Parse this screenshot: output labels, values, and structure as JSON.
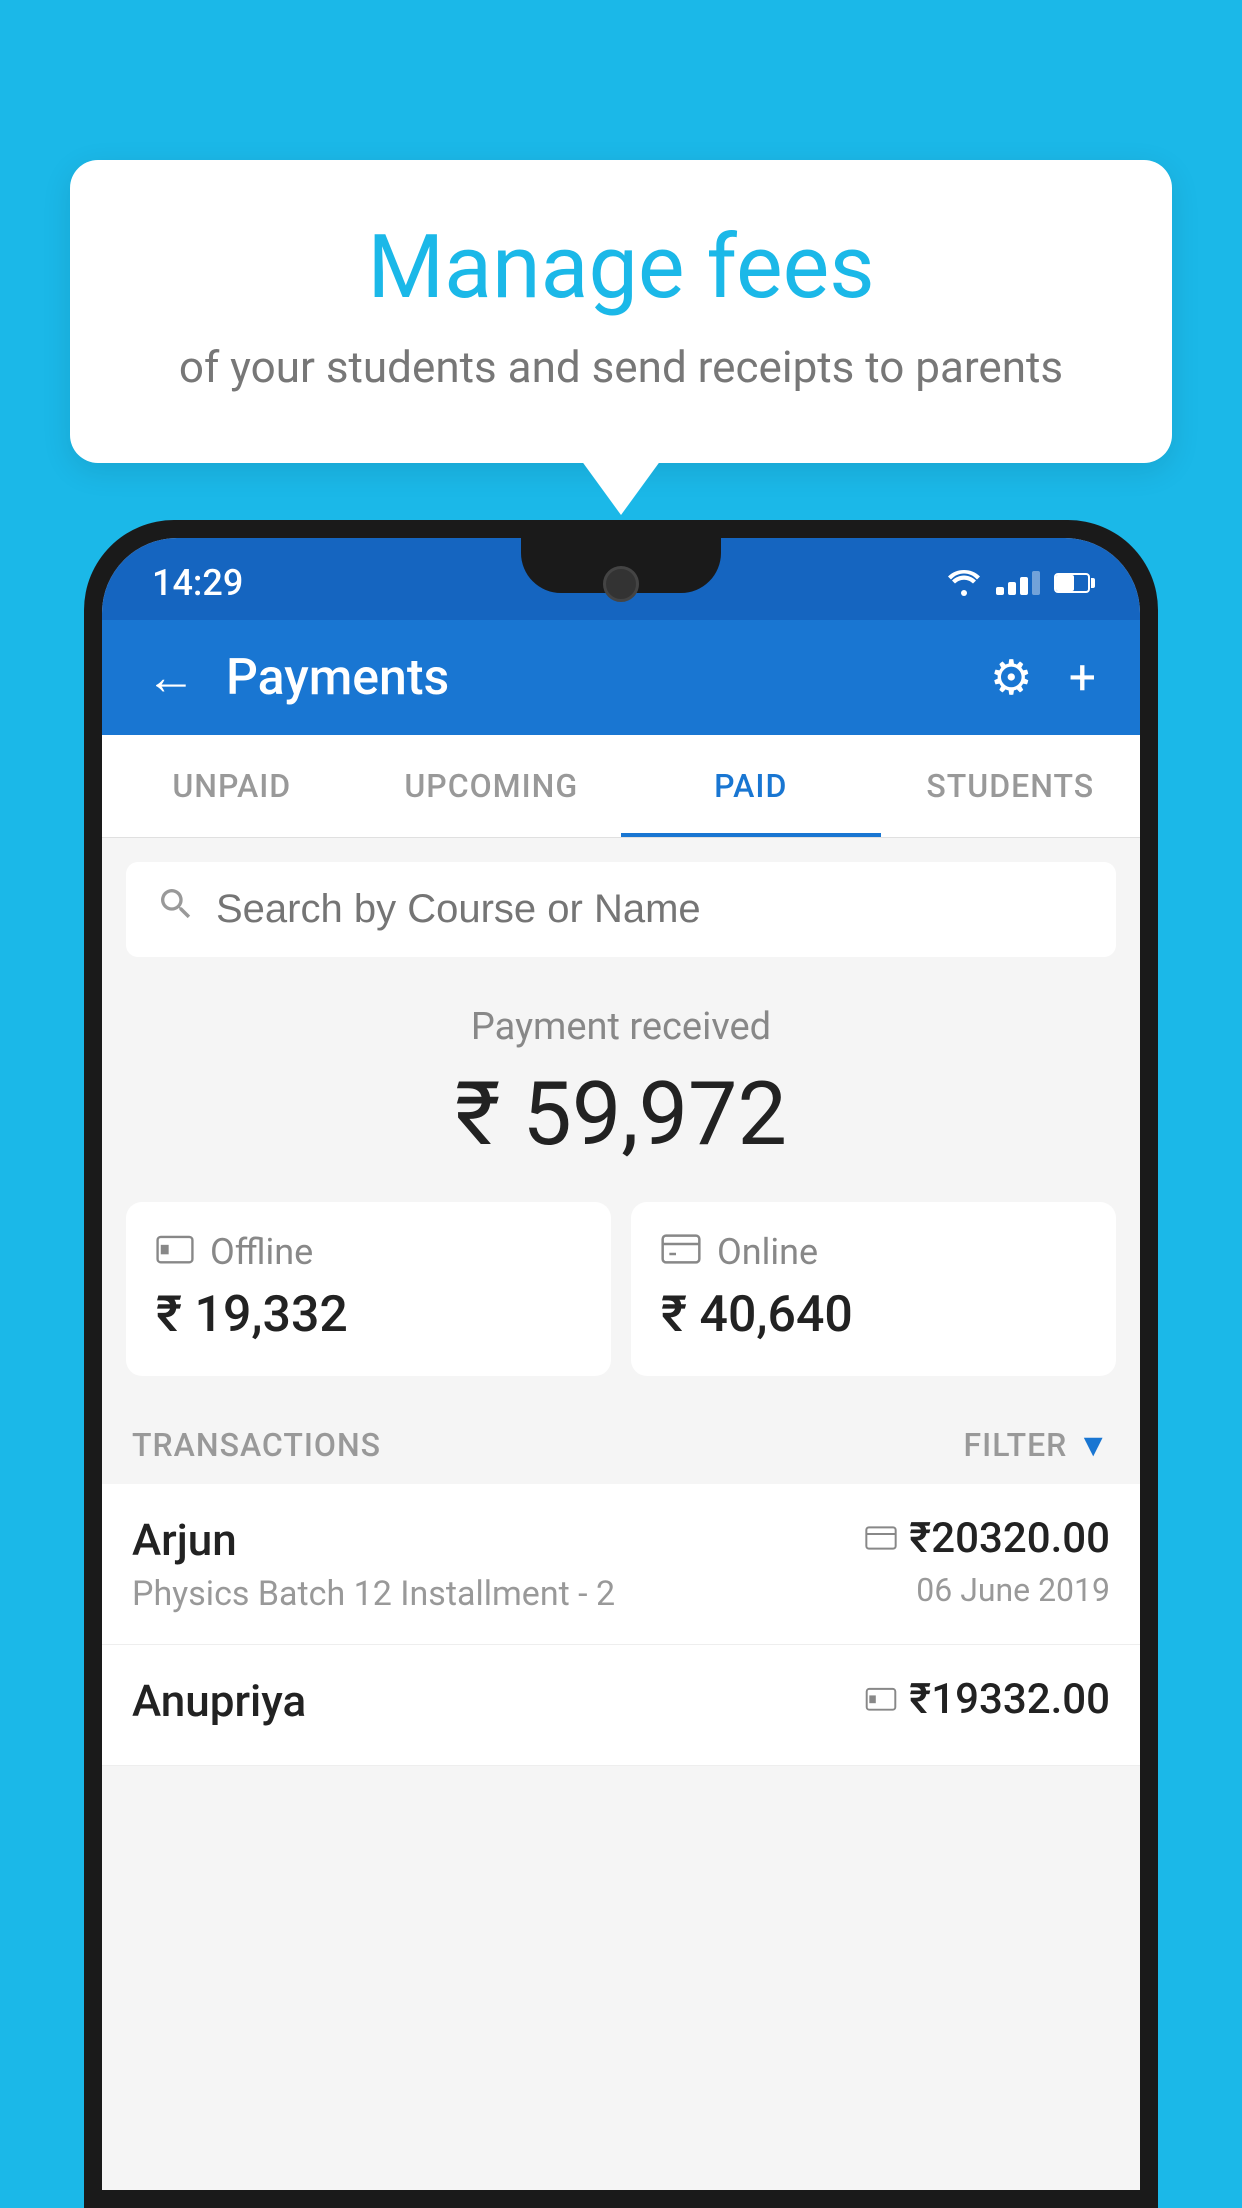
{
  "background_color": "#1bb8e8",
  "bubble": {
    "title": "Manage fees",
    "subtitle": "of your students and send receipts to parents"
  },
  "status_bar": {
    "time": "14:29"
  },
  "app_bar": {
    "title": "Payments",
    "back_label": "←",
    "settings_label": "⚙",
    "add_label": "+"
  },
  "tabs": [
    {
      "id": "unpaid",
      "label": "UNPAID",
      "active": false
    },
    {
      "id": "upcoming",
      "label": "UPCOMING",
      "active": false
    },
    {
      "id": "paid",
      "label": "PAID",
      "active": true
    },
    {
      "id": "students",
      "label": "STUDENTS",
      "active": false
    }
  ],
  "search": {
    "placeholder": "Search by Course or Name"
  },
  "payment_summary": {
    "label": "Payment received",
    "amount": "₹ 59,972",
    "offline_label": "Offline",
    "offline_amount": "₹ 19,332",
    "online_label": "Online",
    "online_amount": "₹ 40,640"
  },
  "transactions_header": {
    "label": "TRANSACTIONS",
    "filter_label": "FILTER"
  },
  "transactions": [
    {
      "name": "Arjun",
      "detail": "Physics Batch 12 Installment - 2",
      "amount": "₹20320.00",
      "date": "06 June 2019",
      "payment_type": "online"
    },
    {
      "name": "Anupriya",
      "detail": "",
      "amount": "₹19332.00",
      "date": "",
      "payment_type": "offline"
    }
  ]
}
